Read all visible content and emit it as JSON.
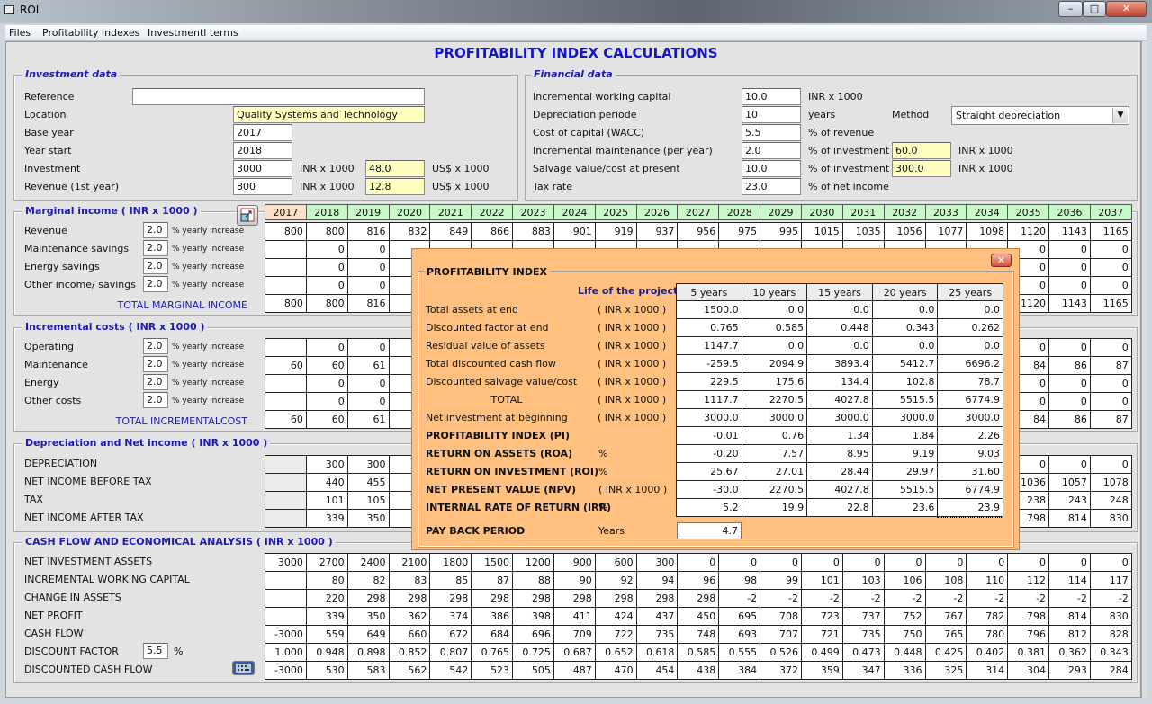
{
  "window": {
    "title": "ROI",
    "minimize": "–",
    "maximize": "□",
    "close": "✕"
  },
  "menu": [
    "Files",
    "Profitability Indexes",
    "Investmentl terms"
  ],
  "page_title": "PROFITABILITY INDEX CALCULATIONS",
  "investment": {
    "title": "Investment data",
    "reference_label": "Reference",
    "reference_value": "",
    "location_label": "Location",
    "location_value": "Quality Systems and Technology",
    "base_year_label": "Base year",
    "base_year": "2017",
    "year_start_label": "Year start",
    "year_start": "2018",
    "investment_label": "Investment",
    "investment_value": "3000",
    "investment_unit": "INR x 1000",
    "investment_usd": "48.0",
    "usd_unit": "US$ x 1000",
    "revenue_label": "Revenue (1st year)",
    "revenue_value": "800",
    "revenue_unit": "INR x 1000",
    "revenue_usd": "12.8",
    "revenue_usd_unit": "US$ x 1000"
  },
  "financial": {
    "title": "Financial data",
    "rows": [
      {
        "label": "Incremental working capital",
        "value": "10.0",
        "unit": "INR x 1000"
      },
      {
        "label": "Depreciation periode",
        "value": "10",
        "unit": "years"
      },
      {
        "label": "Cost of capital (WACC)",
        "value": "5.5",
        "unit": "% of revenue"
      },
      {
        "label": "Incremental maintenance (per year)",
        "value": "2.0",
        "unit": "% of investment",
        "extra": "60.0",
        "extra_unit": "INR x 1000"
      },
      {
        "label": "Salvage value/cost at present",
        "value": "10.0",
        "unit": "% of investment",
        "extra": "300.0",
        "extra_unit": "INR x 1000"
      },
      {
        "label": "Tax rate",
        "value": "23.0",
        "unit": "% of net income"
      }
    ],
    "method_label": "Method",
    "method_value": "Straight depreciation"
  },
  "years": [
    "2017",
    "2018",
    "2019",
    "2020",
    "2021",
    "2022",
    "2023",
    "2024",
    "2025",
    "2026",
    "2027",
    "2028",
    "2029",
    "2030",
    "2031",
    "2032",
    "2033",
    "2034",
    "2035",
    "2036",
    "2037"
  ],
  "marginal": {
    "title": "Marginal income ( INR x 1000 )",
    "increase_label": "% yearly increase",
    "total_label": "TOTAL MARGINAL INCOME",
    "rows": [
      {
        "label": "Revenue",
        "rate": "2.0",
        "values": [
          "800",
          "800",
          "816",
          "832",
          "849",
          "866",
          "883",
          "901",
          "919",
          "937",
          "956",
          "975",
          "995",
          "1015",
          "1035",
          "1056",
          "1077",
          "1098",
          "1120",
          "1143",
          "1165"
        ]
      },
      {
        "label": "Maintenance savings",
        "rate": "2.0",
        "values": [
          "",
          "0",
          "0",
          "",
          "",
          "",
          "",
          "",
          "",
          "",
          "",
          "",
          "",
          "",
          "",
          "",
          "",
          "",
          "0",
          "0",
          "0"
        ]
      },
      {
        "label": "Energy savings",
        "rate": "2.0",
        "values": [
          "",
          "0",
          "0",
          "",
          "",
          "",
          "",
          "",
          "",
          "",
          "",
          "",
          "",
          "",
          "",
          "",
          "",
          "",
          "0",
          "0",
          "0"
        ]
      },
      {
        "label": "Other income/ savings",
        "rate": "2.0",
        "values": [
          "",
          "0",
          "0",
          "",
          "",
          "",
          "",
          "",
          "",
          "",
          "",
          "",
          "",
          "",
          "",
          "",
          "",
          "",
          "0",
          "0",
          "0"
        ]
      }
    ],
    "total": [
      "800",
      "800",
      "816",
      "",
      "",
      "",
      "",
      "",
      "",
      "",
      "",
      "",
      "",
      "",
      "",
      "",
      "",
      "",
      "1120",
      "1143",
      "1165"
    ]
  },
  "costs": {
    "title": "Incremental costs ( INR x 1000 )",
    "increase_label": "% yearly increase",
    "total_label": "TOTAL INCREMENTALCOST",
    "rows": [
      {
        "label": "Operating",
        "rate": "2.0",
        "values": [
          "",
          "0",
          "0",
          "",
          "",
          "",
          "",
          "",
          "",
          "",
          "",
          "",
          "",
          "",
          "",
          "",
          "",
          "",
          "0",
          "0",
          "0"
        ]
      },
      {
        "label": "Maintenance",
        "rate": "2.0",
        "values": [
          "60",
          "60",
          "61",
          "",
          "",
          "",
          "",
          "",
          "",
          "",
          "",
          "",
          "",
          "",
          "",
          "",
          "",
          "",
          "84",
          "86",
          "87"
        ]
      },
      {
        "label": "Energy",
        "rate": "2.0",
        "values": [
          "",
          "0",
          "0",
          "",
          "",
          "",
          "",
          "",
          "",
          "",
          "",
          "",
          "",
          "",
          "",
          "",
          "",
          "",
          "0",
          "0",
          "0"
        ]
      },
      {
        "label": "Other costs",
        "rate": "2.0",
        "values": [
          "",
          "0",
          "0",
          "",
          "",
          "",
          "",
          "",
          "",
          "",
          "",
          "",
          "",
          "",
          "",
          "",
          "",
          "",
          "0",
          "0",
          "0"
        ]
      }
    ],
    "total": [
      "60",
      "60",
      "61",
      "",
      "",
      "",
      "",
      "",
      "",
      "",
      "",
      "",
      "",
      "",
      "",
      "",
      "",
      "",
      "84",
      "86",
      "87"
    ]
  },
  "depreciation": {
    "title": "Depreciation and Net income ( INR x 1000 )",
    "rows": [
      {
        "label": "DEPRECIATION",
        "values": [
          "",
          "300",
          "300",
          "",
          "",
          "",
          "",
          "",
          "",
          "",
          "",
          "",
          "",
          "",
          "",
          "",
          "",
          "",
          "0",
          "0",
          "0"
        ]
      },
      {
        "label": "NET INCOME BEFORE TAX",
        "values": [
          "",
          "440",
          "455",
          "",
          "",
          "",
          "",
          "",
          "",
          "",
          "",
          "",
          "",
          "",
          "",
          "",
          "",
          "",
          "1036",
          "1057",
          "1078"
        ]
      },
      {
        "label": "TAX",
        "values": [
          "",
          "101",
          "105",
          "",
          "",
          "",
          "",
          "",
          "",
          "",
          "",
          "",
          "",
          "",
          "",
          "",
          "",
          "",
          "238",
          "243",
          "248"
        ]
      },
      {
        "label": "NET INCOME AFTER TAX",
        "values": [
          "",
          "339",
          "350",
          "",
          "",
          "",
          "",
          "",
          "",
          "",
          "",
          "",
          "",
          "",
          "",
          "",
          "",
          "",
          "798",
          "814",
          "830"
        ]
      }
    ]
  },
  "cashflow": {
    "title": "CASH FLOW AND ECONOMICAL ANALYSIS ( INR x 1000 )",
    "discount_rate": "5.5",
    "discount_unit": "%",
    "rows": [
      {
        "label": "NET INVESTMENT ASSETS",
        "values": [
          "3000",
          "2700",
          "2400",
          "2100",
          "1800",
          "1500",
          "1200",
          "900",
          "600",
          "300",
          "0",
          "0",
          "0",
          "0",
          "0",
          "0",
          "0",
          "0",
          "0",
          "0",
          "0"
        ]
      },
      {
        "label": "INCREMENTAL WORKING CAPITAL",
        "values": [
          "",
          "80",
          "82",
          "83",
          "85",
          "87",
          "88",
          "90",
          "92",
          "94",
          "96",
          "98",
          "99",
          "101",
          "103",
          "106",
          "108",
          "110",
          "112",
          "114",
          "117"
        ]
      },
      {
        "label": "CHANGE IN ASSETS",
        "values": [
          "",
          "220",
          "298",
          "298",
          "298",
          "298",
          "298",
          "298",
          "298",
          "298",
          "298",
          "-2",
          "-2",
          "-2",
          "-2",
          "-2",
          "-2",
          "-2",
          "-2",
          "-2",
          "-2"
        ]
      },
      {
        "label": "NET PROFIT",
        "values": [
          "",
          "339",
          "350",
          "362",
          "374",
          "386",
          "398",
          "411",
          "424",
          "437",
          "450",
          "695",
          "708",
          "723",
          "737",
          "752",
          "767",
          "782",
          "798",
          "814",
          "830"
        ]
      },
      {
        "label": "CASH FLOW",
        "values": [
          "-3000",
          "559",
          "649",
          "660",
          "672",
          "684",
          "696",
          "709",
          "722",
          "735",
          "748",
          "693",
          "707",
          "721",
          "735",
          "750",
          "765",
          "780",
          "796",
          "812",
          "828"
        ]
      },
      {
        "label": "DISCOUNT FACTOR",
        "values": [
          "1.000",
          "0.948",
          "0.898",
          "0.852",
          "0.807",
          "0.765",
          "0.725",
          "0.687",
          "0.652",
          "0.618",
          "0.585",
          "0.555",
          "0.526",
          "0.499",
          "0.473",
          "0.448",
          "0.425",
          "0.402",
          "0.381",
          "0.362",
          "0.343"
        ]
      },
      {
        "label": "DISCOUNTED CASH FLOW",
        "values": [
          "-3000",
          "530",
          "583",
          "562",
          "542",
          "523",
          "505",
          "487",
          "470",
          "454",
          "438",
          "384",
          "372",
          "359",
          "347",
          "336",
          "325",
          "314",
          "304",
          "293",
          "284"
        ]
      }
    ]
  },
  "popup": {
    "title": "PROFITABILITY INDEX",
    "life_label": "Life of the project",
    "close": "✕",
    "columns": [
      "5 years",
      "10 years",
      "15 years",
      "20 years",
      "25 years"
    ],
    "rows": [
      {
        "label": "Total assets at end",
        "unit": "( INR x 1000 )",
        "values": [
          "1500.0",
          "0.0",
          "0.0",
          "0.0",
          "0.0"
        ]
      },
      {
        "label": "Discounted factor at end",
        "unit": "( INR x 1000 )",
        "values": [
          "0.765",
          "0.585",
          "0.448",
          "0.343",
          "0.262"
        ]
      },
      {
        "label": "Residual value of assets",
        "unit": "( INR x 1000 )",
        "values": [
          "1147.7",
          "0.0",
          "0.0",
          "0.0",
          "0.0"
        ]
      },
      {
        "label": "Total discounted cash flow",
        "unit": "( INR x 1000 )",
        "values": [
          "-259.5",
          "2094.9",
          "3893.4",
          "5412.7",
          "6696.2"
        ]
      },
      {
        "label": "Discounted salvage value/cost",
        "unit": "( INR x 1000 )",
        "values": [
          "229.5",
          "175.6",
          "134.4",
          "102.8",
          "78.7"
        ]
      },
      {
        "label": "TOTAL",
        "unit": "( INR x 1000 )",
        "values": [
          "1117.7",
          "2270.5",
          "4027.8",
          "5515.5",
          "6774.9"
        ],
        "center": true
      },
      {
        "label": "Net investment at beginning",
        "unit": "( INR x 1000 )",
        "values": [
          "3000.0",
          "3000.0",
          "3000.0",
          "3000.0",
          "3000.0"
        ]
      },
      {
        "label": "PROFITABILITY INDEX (PI)",
        "unit": "",
        "values": [
          "-0.01",
          "0.76",
          "1.34",
          "1.84",
          "2.26"
        ],
        "bold": true
      },
      {
        "label": "RETURN ON ASSETS (ROA)",
        "unit": "%",
        "values": [
          "-0.20",
          "7.57",
          "8.95",
          "9.19",
          "9.03"
        ],
        "bold": true
      },
      {
        "label": "RETURN ON INVESTMENT (ROI)",
        "unit": "%",
        "values": [
          "25.67",
          "27.01",
          "28.44",
          "29.97",
          "31.60"
        ],
        "bold": true
      },
      {
        "label": "NET PRESENT VALUE (NPV)",
        "unit": "( INR x 1000 )",
        "values": [
          "-30.0",
          "2270.5",
          "4027.8",
          "5515.5",
          "6774.9"
        ],
        "bold": true
      },
      {
        "label": "INTERNAL RATE OF RETURN (IRR)",
        "unit": "%",
        "values": [
          "5.2",
          "19.9",
          "22.8",
          "23.6",
          "23.9"
        ],
        "bold": true
      }
    ],
    "payback_label": "PAY BACK PERIOD",
    "payback_unit": "Years",
    "payback_value": "4.7"
  },
  "colors": {
    "title_blue": "#1414c8",
    "popup_bg": "#ffc080",
    "year_header": "#c8f8c8",
    "base_year_header": "#fde0c8",
    "highlight_input": "#ffffc0"
  }
}
